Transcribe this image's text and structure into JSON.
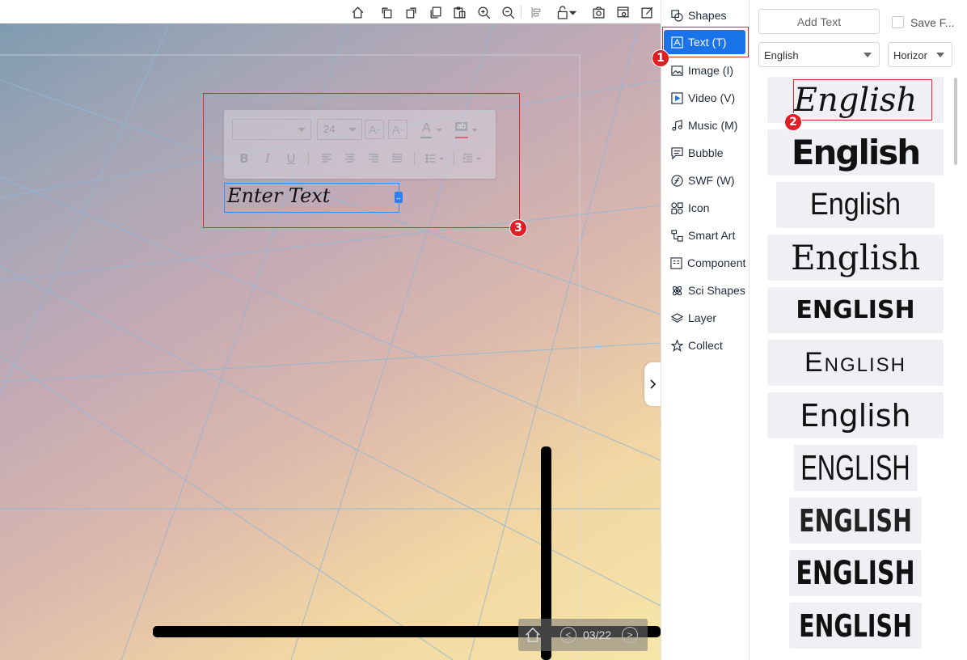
{
  "toolbar": {
    "icons": [
      "home-icon",
      "rotate-left-icon",
      "rotate-right-icon",
      "copy-icon",
      "paste-icon",
      "zoom-in-icon",
      "zoom-out-icon",
      "align-icon",
      "lock-icon",
      "camera-icon",
      "screen-record-icon",
      "edit-icon"
    ]
  },
  "format_toolbar": {
    "font_family_value": "",
    "font_size_value": "24",
    "increase_font_label": "A",
    "decrease_font_label": "A",
    "font_color_label": "A",
    "highlight_label": "ab",
    "bold_label": "B",
    "italic_label": "I",
    "underline_label": "U"
  },
  "canvas": {
    "text_box_value": "Enter Text",
    "page_counter": "03/22",
    "prev_label": "<",
    "next_label": ">"
  },
  "annotations": {
    "badge_1": "1",
    "badge_2": "2",
    "badge_3": "3"
  },
  "insert_menu": {
    "items": [
      {
        "label": "Shapes",
        "icon": "shapes-icon",
        "active": false
      },
      {
        "label": "Text (T)",
        "icon": "text-icon",
        "active": true
      },
      {
        "label": "Image (I)",
        "icon": "image-icon",
        "active": false
      },
      {
        "label": "Video (V)",
        "icon": "video-icon",
        "active": false
      },
      {
        "label": "Music (M)",
        "icon": "music-icon",
        "active": false
      },
      {
        "label": "Bubble",
        "icon": "bubble-icon",
        "active": false
      },
      {
        "label": "SWF (W)",
        "icon": "swf-icon",
        "active": false
      },
      {
        "label": "Icon",
        "icon": "icon-grid-icon",
        "active": false
      },
      {
        "label": "Smart Art",
        "icon": "smart-art-icon",
        "active": false
      },
      {
        "label": "Component",
        "icon": "component-icon",
        "active": false
      },
      {
        "label": "Sci Shapes",
        "icon": "sci-shapes-icon",
        "active": false
      },
      {
        "label": "Layer",
        "icon": "layer-icon",
        "active": false
      },
      {
        "label": "Collect",
        "icon": "star-icon",
        "active": false
      }
    ]
  },
  "font_panel": {
    "add_text_label": "Add Text",
    "save_font_label": "Save F...",
    "language_value": "English",
    "direction_value": "Horizor",
    "samples": [
      {
        "text": "English"
      },
      {
        "text": "English"
      },
      {
        "text": "English"
      },
      {
        "text": "English"
      },
      {
        "text": "ENGLISH"
      },
      {
        "text": "English"
      },
      {
        "text": "English"
      },
      {
        "text": "ENGLISH"
      },
      {
        "text": "ENGLISH"
      },
      {
        "text": "ENGLISH"
      },
      {
        "text": "ENGLISH"
      }
    ]
  }
}
